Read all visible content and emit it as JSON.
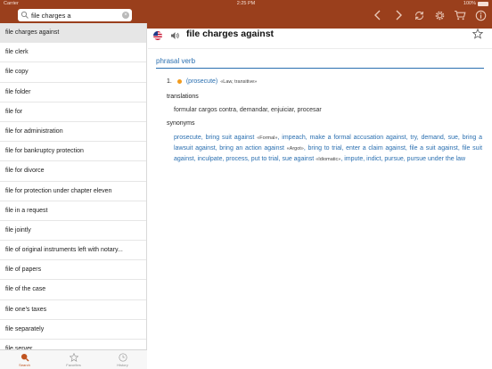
{
  "status": {
    "carrier": "Carrier",
    "time": "2:25 PM",
    "battery": "100%"
  },
  "search": {
    "value": "file charges a",
    "clear_icon": "clear-icon"
  },
  "toolbar": {
    "icons": [
      "back-icon",
      "forward-icon",
      "sync-icon",
      "gear-icon",
      "cart-icon",
      "info-icon"
    ]
  },
  "list": {
    "items": [
      "file charges against",
      "file clerk",
      "file copy",
      "file folder",
      "file for",
      "file for administration",
      "file for bankruptcy protection",
      "file for divorce",
      "file for protection under chapter eleven",
      "file in a request",
      "file jointly",
      "file of original instruments left with notary...",
      "file of papers",
      "file of the case",
      "file one's taxes",
      "file separately",
      "file server"
    ]
  },
  "tabs": [
    {
      "label": "Search",
      "icon": "search-icon"
    },
    {
      "label": "Favorites",
      "icon": "star-icon"
    },
    {
      "label": "History",
      "icon": "clock-icon"
    }
  ],
  "entry": {
    "headword": "file charges against",
    "part_of_speech": "phrasal verb",
    "sense_number": "1.",
    "sense_meaning": "(prosecute)",
    "sense_labels": "«Law, transitive»",
    "translations_title": "translations",
    "translations": "formular cargos contra, demandar, enjuiciar, procesar",
    "synonyms_title": "synonyms",
    "syn": {
      "s1": "prosecute",
      "s2": "bring suit against",
      "tag1": "«Formal»",
      "s3": "impeach",
      "s4": "make a formal accusation against",
      "s5": "try",
      "s6": "demand",
      "s7": "sue",
      "s8": "bring a lawsuit against",
      "s9": "bring an action against",
      "tag2": "«Argot»",
      "s10": "bring to trial",
      "s11": "enter a claim against",
      "s12": "file a suit against",
      "s13": "file suit against",
      "s14": "inculpate",
      "s15": "process",
      "s16": "put to trial",
      "s17": "sue against",
      "tag3": "«Idiomatic»",
      "s18": "impute",
      "s19": "indict",
      "s20": "pursue",
      "s21": "pursue under the law"
    }
  },
  "colors": {
    "header": "#9a3f1c",
    "link": "#2a6fb0",
    "dot": "#f29b1e",
    "tab_active": "#c0531f"
  }
}
